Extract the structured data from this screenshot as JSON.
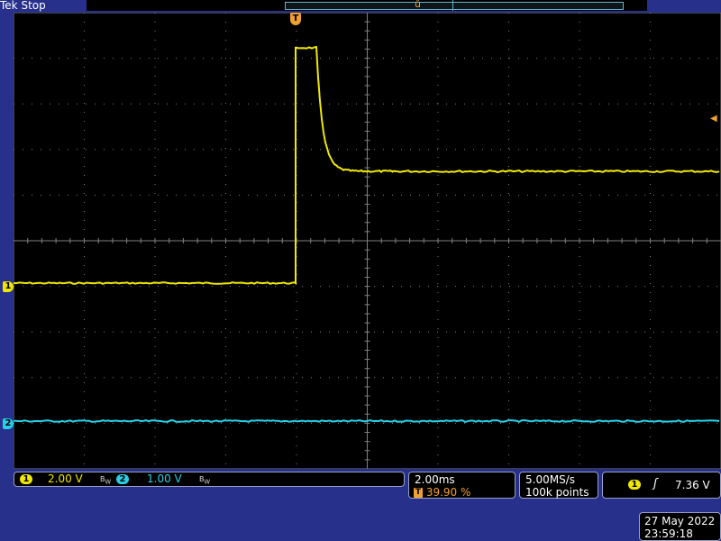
{
  "header": {
    "brand": "Tek",
    "status": "Stop"
  },
  "colors": {
    "ch1": "#f0e800",
    "ch2": "#27d0e8",
    "trigger": "#f0a030",
    "bezel": "#27308a",
    "grid": "#808080"
  },
  "markers": {
    "ch1": "1",
    "ch2": "2",
    "trigger_pos": "T",
    "trigger_level_icon": "arrow-left-icon"
  },
  "channels": {
    "ch1": {
      "badge": "1",
      "scale": "2.00 V",
      "bw_icon": "bw-limit-icon"
    },
    "ch2": {
      "badge": "2",
      "scale": "1.00 V",
      "bw_icon": "bw-limit-icon"
    }
  },
  "timebase": {
    "scale": "2.00ms",
    "trigger_position": "39.90 %",
    "trigger_icon": "T"
  },
  "acquisition": {
    "sample_rate": "5.00MS/s",
    "record_length": "100k points"
  },
  "trigger": {
    "source": "1",
    "slope_icon": "rising-edge-icon",
    "level": "7.36 V"
  },
  "datetime": {
    "date": "27 May 2022",
    "time": "23:59:18"
  }
}
